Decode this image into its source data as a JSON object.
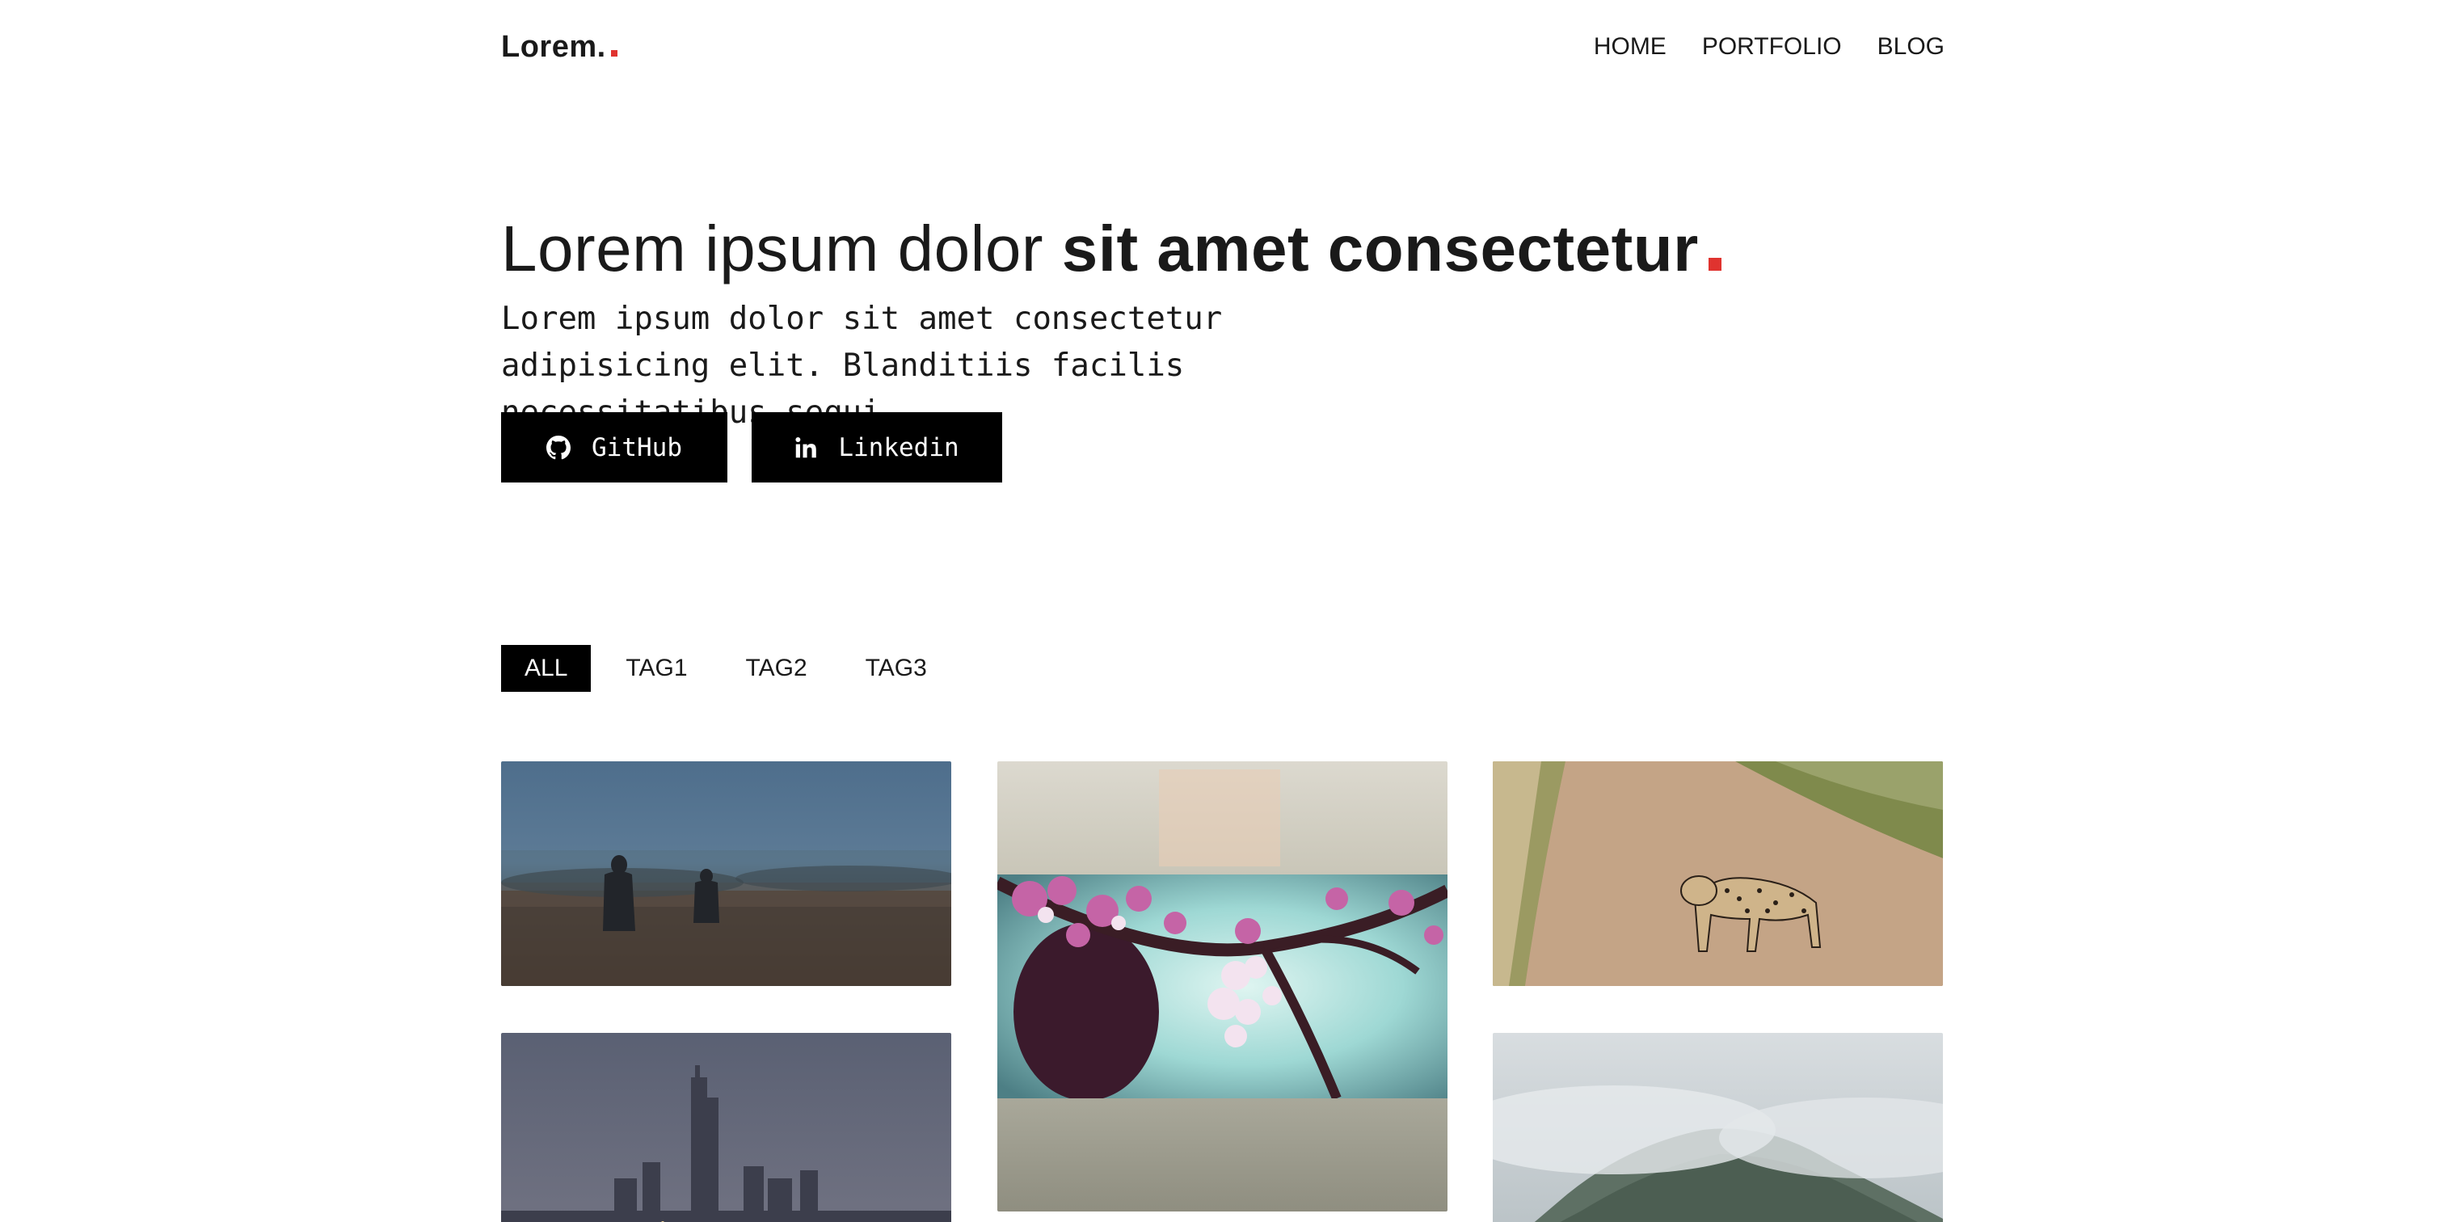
{
  "header": {
    "logo_text": "Lorem.",
    "nav": [
      {
        "label": "HOME"
      },
      {
        "label": "PORTFOLIO"
      },
      {
        "label": "BLOG"
      }
    ]
  },
  "hero": {
    "title_light": "Lorem ipsum dolor ",
    "title_bold": "sit amet consectetur",
    "subtitle": "Lorem ipsum dolor sit amet consectetur adipisicing elit. Blanditiis facilis necessitatibus sequi.",
    "buttons": [
      {
        "label": "GitHub",
        "icon": "github-icon"
      },
      {
        "label": "Linkedin",
        "icon": "linkedin-icon"
      }
    ]
  },
  "filters": {
    "tags": [
      {
        "label": "ALL",
        "active": true
      },
      {
        "label": "TAG1",
        "active": false
      },
      {
        "label": "TAG2",
        "active": false
      },
      {
        "label": "TAG3",
        "active": false
      }
    ]
  },
  "gallery": {
    "items": [
      {
        "subject": "two figures walking in a misty field"
      },
      {
        "subject": "pink cherry blossoms on a branch"
      },
      {
        "subject": "leopard walking on a dirt road"
      },
      {
        "subject": "city skyline with skyscrapers at dusk"
      },
      {
        "subject": "misty green mountain peak"
      }
    ]
  },
  "colors": {
    "accent": "#e0332f",
    "button_bg": "#000000",
    "text": "#1a1a1a"
  }
}
